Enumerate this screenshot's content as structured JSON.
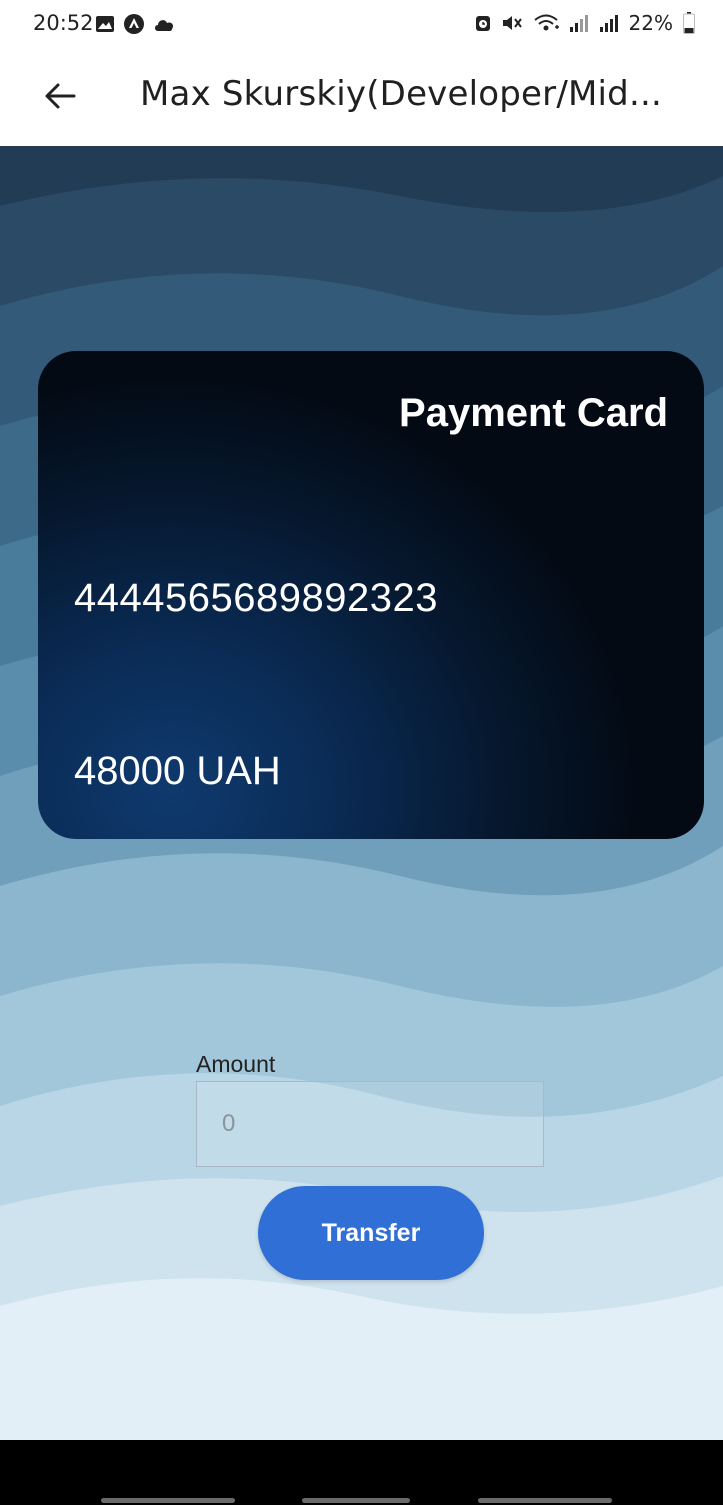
{
  "status_bar": {
    "time": "20:52",
    "battery_percent": "22%",
    "left_icons": [
      "gallery-icon",
      "app-circle-icon",
      "cloud-icon"
    ],
    "right_icons": [
      "alarm-icon",
      "mute-icon",
      "wifi-icon",
      "signal-icon",
      "signal-icon",
      "battery-icon"
    ]
  },
  "app_bar": {
    "title": "Max Skurskiy(Developer/Mid...",
    "back_icon": "arrow-left-icon"
  },
  "card": {
    "title": "Payment Card",
    "number": "4444565689892323",
    "balance": "48000 UAH"
  },
  "form": {
    "amount_label": "Amount",
    "amount_placeholder": "0",
    "transfer_label": "Transfer"
  },
  "colors": {
    "accent": "#2f6fd6",
    "card_dark": "#030a14",
    "card_blue": "#0f3a6e"
  }
}
